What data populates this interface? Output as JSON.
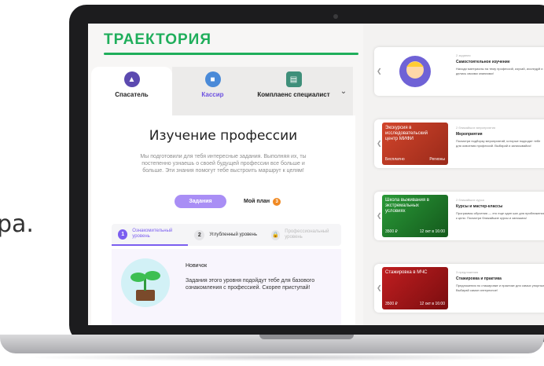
{
  "side_text": "ра.",
  "app": {
    "logo": "ТРАЕКТОРИЯ",
    "tabs": [
      {
        "label": "Спасатель"
      },
      {
        "label": "Кассир"
      },
      {
        "label": "Комплаенс специалист"
      }
    ],
    "title": "Изучение профессии",
    "description": "Мы подготовили для тебя интересные задания. Выполняя их, ты постепенно узнаешь о своей будущей профессии все больше и больше. Эти знания помогут тебе выстроить маршрут к целям!",
    "tasks_button": "Задания",
    "my_plan": "Мой план",
    "my_plan_badge": "3",
    "levels": [
      {
        "num": "1",
        "label": "Ознакомительный уровень"
      },
      {
        "num": "2",
        "label": "Углубленный уровень"
      },
      {
        "num": "",
        "label": "Профессиональный уровень"
      }
    ],
    "novice_title": "Новичок",
    "novice_text": "Задания этого уровня подойдут тебе для базового ознакомления с профессией. Скорее приступай!"
  },
  "side_cards": [
    {
      "image_caption": "",
      "footer_left": "",
      "footer_right": "",
      "kicker": "2 задания",
      "title": "Самостоятельное изучение",
      "text": "Находи материалы на тему профессий, изучай, исследуй и делись своими знаниями!",
      "color": "#ffd75e"
    },
    {
      "image_caption": "Экскурсия в исследовательский центр МИФИ",
      "footer_left": "Бесплатно",
      "footer_right": "Регионы",
      "kicker": "2 ближайших мероприятия",
      "title": "Мероприятия",
      "text": "Посмотри подборку мероприятий, которые подходят тебе для освоения профессий. Выбирай и записывайся!",
      "color": "#d2452b"
    },
    {
      "image_caption": "Школа выживания в экстремальных условиях",
      "footer_left": "3500 ₽",
      "footer_right": "12 окт в 16:00",
      "kicker": "2 ближайших курса",
      "title": "Курсы и мастер-классы",
      "text": "Программы обучения — это еще один шаг для приближения к цели. Посмотри ближайшие курсы и запишись!",
      "color": "#1f7d2a"
    },
    {
      "image_caption": "Стажировка в МЧС",
      "footer_left": "3500 ₽",
      "footer_right": "12 окт в 16:00",
      "kicker": "3 предложения",
      "title": "Стажировка и практика",
      "text": "Предложения по стажировке и практике для самых упорных. Выбирай самое интересное!",
      "color": "#b3171a"
    }
  ]
}
